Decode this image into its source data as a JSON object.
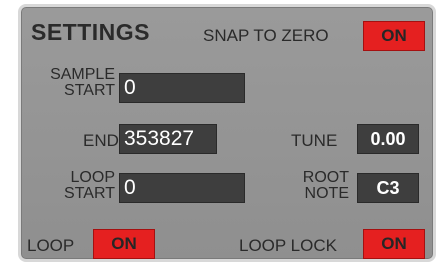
{
  "panel": {
    "title": "SETTINGS"
  },
  "snap_to_zero": {
    "label": "SNAP TO ZERO",
    "state": "ON"
  },
  "sample_start": {
    "label_line1": "SAMPLE",
    "label_line2": "START",
    "value": "0"
  },
  "end": {
    "label": "END",
    "value": "353827"
  },
  "tune": {
    "label": "TUNE",
    "value": "0.00"
  },
  "loop_start": {
    "label_line1": "LOOP",
    "label_line2": "START",
    "value": "0"
  },
  "root_note": {
    "label_line1": "ROOT",
    "label_line2": "NOTE",
    "value": "C3"
  },
  "loop": {
    "label": "LOOP",
    "state": "ON"
  },
  "loop_lock": {
    "label": "LOOP LOCK",
    "state": "ON"
  },
  "colors": {
    "panel_bg": "#969696",
    "field_bg": "#3e3e3e",
    "toggle_on": "#e52020"
  }
}
